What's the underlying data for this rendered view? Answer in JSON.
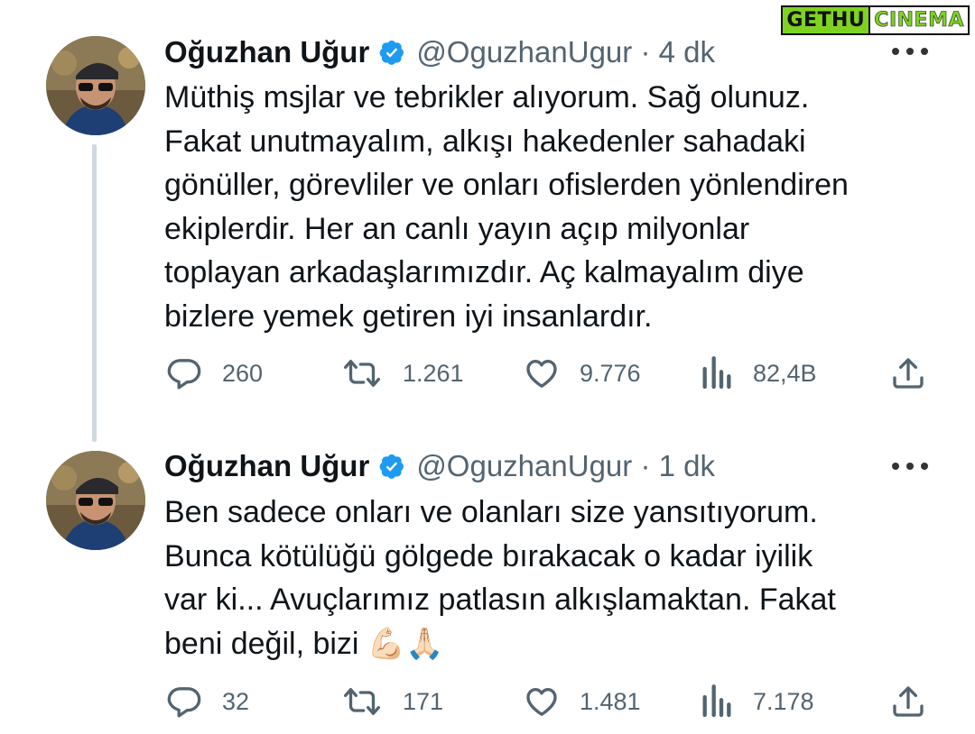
{
  "watermark": {
    "part1": "GETHU",
    "part2": "CINEMA"
  },
  "tweets": [
    {
      "name": "Oğuzhan Uğur",
      "handle_time": "@OguzhanUgur · 4 dk",
      "text": "Müthiş msjlar ve tebrikler alıyorum. Sağ olunuz.\nFakat unutmayalım, alkışı hakedenler sahadaki\ngönüller, görevliler ve onları ofislerden yönlendiren\nekiplerdir. Her an canlı yayın açıp milyonlar\ntoplayan arkadaşlarımızdır. Aç kalmayalım diye\nbizlere yemek getiren iyi insanlardır.",
      "replies": "260",
      "retweets": "1.261",
      "likes": "9.776",
      "views": "82,4B"
    },
    {
      "name": "Oğuzhan Uğur",
      "handle_time": "@OguzhanUgur · 1 dk",
      "text": "Ben sadece onları ve olanları size yansıtıyorum.\nBunca kötülüğü gölgede bırakacak o kadar iyilik\nvar ki... Avuçlarımız patlasın alkışlamaktan. Fakat\nbeni değil, bizi 💪🏻🙏🏻",
      "replies": "32",
      "retweets": "171",
      "likes": "1.481",
      "views": "7.178"
    }
  ],
  "icons": {
    "reply": "speech-bubble-icon",
    "retweet": "retweet-arrows-icon",
    "like": "heart-icon",
    "views": "bar-chart-icon",
    "share": "share-upload-icon",
    "verified": "verified-badge-icon",
    "more": "more-options-icon"
  },
  "colors": {
    "verified_badge": "#1d9bf0",
    "muted_text": "#536471",
    "thread_line": "#cfd9de"
  }
}
